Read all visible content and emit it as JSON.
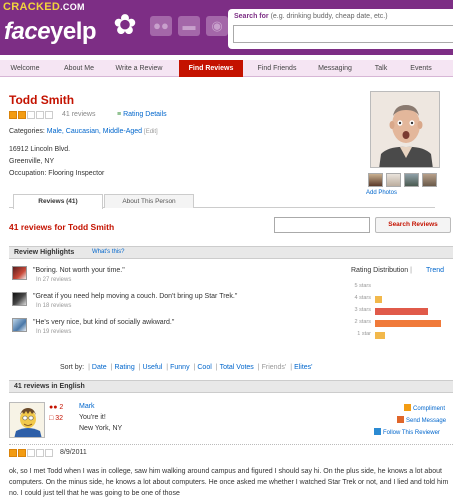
{
  "watermark": {
    "left": "CRACKED",
    "right": ".COM"
  },
  "brand": {
    "face": "face",
    "yelp": "yelp"
  },
  "header": {
    "icons": [
      "friends-icon",
      "messages-icon",
      "globe-icon"
    ],
    "search_label": "Search for",
    "search_hint": "(e.g. drinking buddy, cheap date, etc.)",
    "search_value": ""
  },
  "nav": {
    "items": [
      {
        "label": "Welcome",
        "active": false
      },
      {
        "label": "About Me",
        "active": false
      },
      {
        "label": "Write a Review",
        "active": false
      },
      {
        "label": "Find Reviews",
        "active": true
      },
      {
        "label": "Find Friends",
        "active": false
      },
      {
        "label": "Messaging",
        "active": false
      },
      {
        "label": "Talk",
        "active": false
      },
      {
        "label": "Events",
        "active": false
      }
    ]
  },
  "profile": {
    "name": "Todd Smith",
    "rating_stars": 2,
    "review_count": "41 reviews",
    "rating_details": "Rating Details",
    "categories_label": "Categories:",
    "categories": "Male, Caucasian, Middle-Aged",
    "edit": "[Edit]",
    "address1": "16912 Lincoln Blvd.",
    "address2": "Greenville, NY",
    "occupation": "Occupation: Flooring Inspector",
    "add_photos": "Add Photos"
  },
  "tabs": [
    {
      "label": "Reviews (41)",
      "active": true
    },
    {
      "label": "About This Person",
      "active": false
    }
  ],
  "reviews_for": "41 reviews for Todd Smith",
  "review_search": {
    "value": "",
    "button": "Search Reviews"
  },
  "highlights": {
    "title": "Review Highlights",
    "whats_this": "What's this?",
    "items": [
      {
        "quote": "\"Boring. Not worth your time.\"",
        "count": "In 27 reviews"
      },
      {
        "quote": "\"Great if you need help moving a couch. Don't bring up Star Trek.\"",
        "count": "In 18 reviews"
      },
      {
        "quote": "\"He's very nice, but kind of socially awkward.\"",
        "count": "In 19 reviews"
      }
    ]
  },
  "distribution": {
    "label": "Rating Distribution",
    "sep": "|",
    "trend": "Trend",
    "rows": [
      {
        "label": "5 stars",
        "value": 0.0,
        "color": "#f2b84b"
      },
      {
        "label": "4 stars",
        "value": 0.1,
        "color": "#f2b84b"
      },
      {
        "label": "3 stars",
        "value": 0.8,
        "color": "#e05a4a"
      },
      {
        "label": "2 stars",
        "value": 1.0,
        "color": "#f07a3a"
      },
      {
        "label": "1 star",
        "value": 0.15,
        "color": "#f2b84b"
      }
    ]
  },
  "sort": {
    "label": "Sort by:",
    "options": [
      {
        "label": "Date",
        "dim": false
      },
      {
        "label": "Rating",
        "dim": false
      },
      {
        "label": "Useful",
        "dim": false
      },
      {
        "label": "Funny",
        "dim": false
      },
      {
        "label": "Cool",
        "dim": false
      },
      {
        "label": "Total Votes",
        "dim": false
      },
      {
        "label": "Friends'",
        "dim": true
      },
      {
        "label": "Elites'",
        "dim": false
      }
    ]
  },
  "reviews_section": "41 reviews in English",
  "review": {
    "friends": "2",
    "reviews": "32",
    "name": "Mark",
    "tagline": "You're it!",
    "location": "New York, NY",
    "actions": [
      "Compliment",
      "Send Message",
      "Follow This Reviewer"
    ],
    "rating_stars": 2,
    "date": "8/9/2011",
    "body": "ok, so I met Todd when I was in college, saw him walking around campus and figured I should say hi. On the plus side, he knows a lot about computers. On the minus side, he knows a lot about computers. He once asked me whether I watched Star Trek or not, and I lied and told him no. I could just tell that he was going to be one of those"
  },
  "colors": {
    "brand": "#7d2e85",
    "accent": "#c41200",
    "link": "#0066cc"
  }
}
